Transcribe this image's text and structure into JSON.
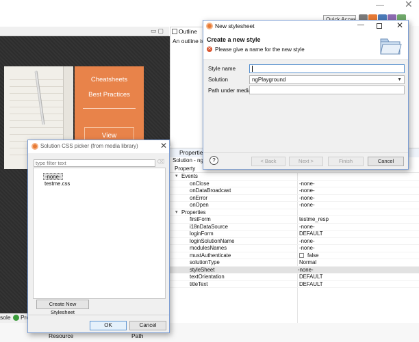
{
  "top": {
    "quick_access": "Quick Access"
  },
  "editor": {
    "card_title": "Cheatsheets",
    "card_subtitle": "Best Practices",
    "card_button": "View"
  },
  "outline": {
    "tab": "Outline",
    "message": "An outline is not available."
  },
  "properties": {
    "tab": "Properties",
    "subtitle": "Solution - ngP",
    "header_property": "Property",
    "rows": [
      {
        "kind": "group",
        "name": "Events"
      },
      {
        "kind": "prop",
        "name": "onClose",
        "value": "-none-"
      },
      {
        "kind": "prop",
        "name": "onDataBroadcast",
        "value": "-none-"
      },
      {
        "kind": "prop",
        "name": "onError",
        "value": "-none-"
      },
      {
        "kind": "prop",
        "name": "onOpen",
        "value": "-none-"
      },
      {
        "kind": "group",
        "name": "Properties"
      },
      {
        "kind": "prop",
        "name": "firstForm",
        "value": "testme_resp"
      },
      {
        "kind": "prop",
        "name": "i18nDataSource",
        "value": "-none-"
      },
      {
        "kind": "prop",
        "name": "loginForm",
        "value": "DEFAULT"
      },
      {
        "kind": "prop",
        "name": "loginSolutionName",
        "value": "-none-"
      },
      {
        "kind": "prop",
        "name": "modulesNames",
        "value": "-none-"
      },
      {
        "kind": "prop",
        "name": "mustAuthenticate",
        "value": "false",
        "checkbox": true
      },
      {
        "kind": "prop",
        "name": "solutionType",
        "value": "Normal"
      },
      {
        "kind": "prop",
        "name": "styleSheet",
        "value": "-none-",
        "selected": true
      },
      {
        "kind": "prop",
        "name": "textOrientation",
        "value": "DEFAULT"
      },
      {
        "kind": "prop",
        "name": "titleText",
        "value": "DEFAULT"
      }
    ]
  },
  "new_stylesheet_dialog": {
    "title": "New stylesheet",
    "heading": "Create a new style",
    "message": "Please give a name for the new style",
    "style_name_label": "Style name",
    "style_name_value": "",
    "solution_label": "Solution",
    "solution_value": "ngPlayground",
    "path_label": "Path under media",
    "path_value": "",
    "back_label": "< Back",
    "next_label": "Next >",
    "finish_label": "Finish",
    "cancel_label": "Cancel",
    "help_label": "?"
  },
  "css_picker_dialog": {
    "title": "Solution CSS picker (from media library)",
    "filter_placeholder": "type filter text",
    "items": [
      "-none-",
      "testme.css"
    ],
    "selected_item": "-none-",
    "create_label": "Create New Stylesheet",
    "ok_label": "OK",
    "cancel_label": "Cancel"
  },
  "bottom": {
    "tab_console": "sole",
    "tab_pro": "Pro",
    "col_resource": "Resource",
    "col_path": "Path"
  },
  "colors": {
    "card_orange": "#e8834a",
    "servoy_orange": "#e77a35",
    "error_red": "#d9542e",
    "focus_blue": "#5b93d0"
  }
}
